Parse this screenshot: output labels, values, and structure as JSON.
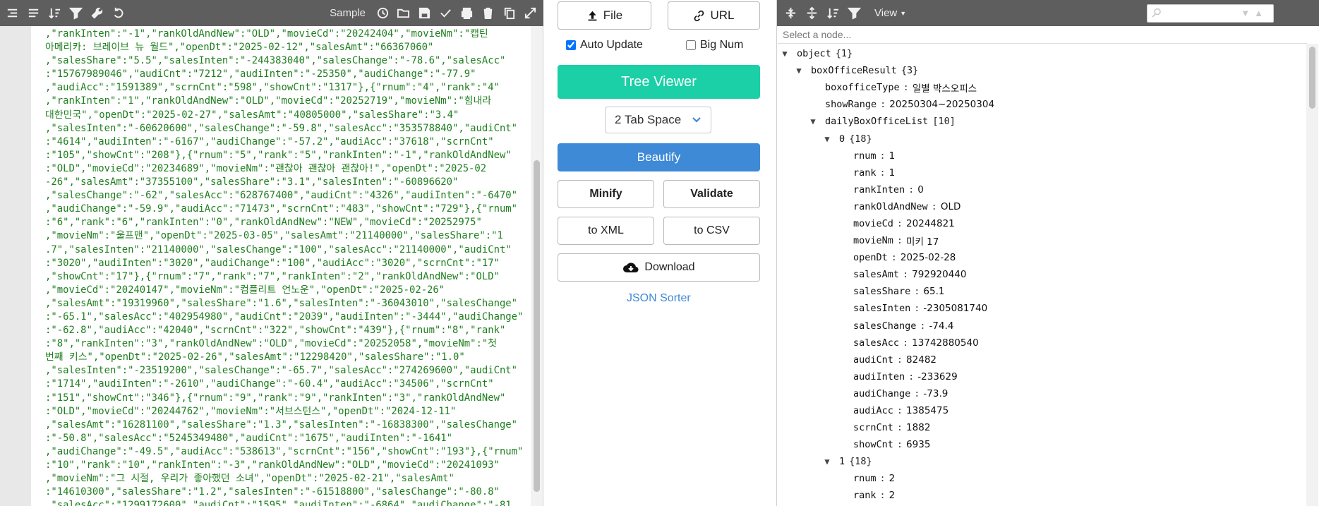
{
  "left": {
    "sample_label": "Sample",
    "code_lines": [
      ",\"rankInten\":\"-1\",\"rankOldAndNew\":\"OLD\",\"movieCd\":\"20242404\",\"movieNm\":\"캡틴",
      "아메리카: 브레이브 뉴 월드\",\"openDt\":\"2025-02-12\",\"salesAmt\":\"66367060\"",
      ",\"salesShare\":\"5.5\",\"salesInten\":\"-244383040\",\"salesChange\":\"-78.6\",\"salesAcc\"",
      ":\"15767989046\",\"audiCnt\":\"7212\",\"audiInten\":\"-25350\",\"audiChange\":\"-77.9\"",
      ",\"audiAcc\":\"1591389\",\"scrnCnt\":\"598\",\"showCnt\":\"1317\"},{\"rnum\":\"4\",\"rank\":\"4\"",
      ",\"rankInten\":\"1\",\"rankOldAndNew\":\"OLD\",\"movieCd\":\"20252719\",\"movieNm\":\"힘내라",
      "대한민국\",\"openDt\":\"2025-02-27\",\"salesAmt\":\"40805000\",\"salesShare\":\"3.4\"",
      ",\"salesInten\":\"-60620600\",\"salesChange\":\"-59.8\",\"salesAcc\":\"353578840\",\"audiCnt\"",
      ":\"4614\",\"audiInten\":\"-6167\",\"audiChange\":\"-57.2\",\"audiAcc\":\"37618\",\"scrnCnt\"",
      ":\"105\",\"showCnt\":\"208\"},{\"rnum\":\"5\",\"rank\":\"5\",\"rankInten\":\"-1\",\"rankOldAndNew\"",
      ":\"OLD\",\"movieCd\":\"20234689\",\"movieNm\":\"괜찮아 괜찮아 괜찮아!\",\"openDt\":\"2025-02",
      "-26\",\"salesAmt\":\"37355100\",\"salesShare\":\"3.1\",\"salesInten\":\"-60896620\"",
      ",\"salesChange\":\"-62\",\"salesAcc\":\"628767400\",\"audiCnt\":\"4326\",\"audiInten\":\"-6470\"",
      ",\"audiChange\":\"-59.9\",\"audiAcc\":\"71473\",\"scrnCnt\":\"483\",\"showCnt\":\"729\"},{\"rnum\"",
      ":\"6\",\"rank\":\"6\",\"rankInten\":\"0\",\"rankOldAndNew\":\"NEW\",\"movieCd\":\"20252975\"",
      ",\"movieNm\":\"울프맨\",\"openDt\":\"2025-03-05\",\"salesAmt\":\"21140000\",\"salesShare\":\"1",
      ".7\",\"salesInten\":\"21140000\",\"salesChange\":\"100\",\"salesAcc\":\"21140000\",\"audiCnt\"",
      ":\"3020\",\"audiInten\":\"3020\",\"audiChange\":\"100\",\"audiAcc\":\"3020\",\"scrnCnt\":\"17\"",
      ",\"showCnt\":\"17\"},{\"rnum\":\"7\",\"rank\":\"7\",\"rankInten\":\"2\",\"rankOldAndNew\":\"OLD\"",
      ",\"movieCd\":\"20240147\",\"movieNm\":\"컴플리트 언노운\",\"openDt\":\"2025-02-26\"",
      ",\"salesAmt\":\"19319960\",\"salesShare\":\"1.6\",\"salesInten\":\"-36043010\",\"salesChange\"",
      ":\"-65.1\",\"salesAcc\":\"402954980\",\"audiCnt\":\"2039\",\"audiInten\":\"-3444\",\"audiChange\"",
      ":\"-62.8\",\"audiAcc\":\"42040\",\"scrnCnt\":\"322\",\"showCnt\":\"439\"},{\"rnum\":\"8\",\"rank\"",
      ":\"8\",\"rankInten\":\"3\",\"rankOldAndNew\":\"OLD\",\"movieCd\":\"20252058\",\"movieNm\":\"첫",
      "번째 키스\",\"openDt\":\"2025-02-26\",\"salesAmt\":\"12298420\",\"salesShare\":\"1.0\"",
      ",\"salesInten\":\"-23519200\",\"salesChange\":\"-65.7\",\"salesAcc\":\"274269600\",\"audiCnt\"",
      ":\"1714\",\"audiInten\":\"-2610\",\"audiChange\":\"-60.4\",\"audiAcc\":\"34506\",\"scrnCnt\"",
      ":\"151\",\"showCnt\":\"346\"},{\"rnum\":\"9\",\"rank\":\"9\",\"rankInten\":\"3\",\"rankOldAndNew\"",
      ":\"OLD\",\"movieCd\":\"20244762\",\"movieNm\":\"서브스턴스\",\"openDt\":\"2024-12-11\"",
      ",\"salesAmt\":\"16281100\",\"salesShare\":\"1.3\",\"salesInten\":\"-16838300\",\"salesChange\"",
      ":\"-50.8\",\"salesAcc\":\"5245349480\",\"audiCnt\":\"1675\",\"audiInten\":\"-1641\"",
      ",\"audiChange\":\"-49.5\",\"audiAcc\":\"538613\",\"scrnCnt\":\"156\",\"showCnt\":\"193\"},{\"rnum\"",
      ":\"10\",\"rank\":\"10\",\"rankInten\":\"-3\",\"rankOldAndNew\":\"OLD\",\"movieCd\":\"20241093\"",
      ",\"movieNm\":\"그 시절, 우리가 좋아했던 소녀\",\"openDt\":\"2025-02-21\",\"salesAmt\"",
      ":\"14610300\",\"salesShare\":\"1.2\",\"salesInten\":\"-61518800\",\"salesChange\":\"-80.8\"",
      ",\"salesAcc\":\"1299172600\",\"audiCnt\":\"1595\",\"audiInten\":\"-6864\",\"audiChange\":\"-81"
    ]
  },
  "mid": {
    "file_label": "File",
    "url_label": "URL",
    "auto_update_label": "Auto Update",
    "auto_update_checked": true,
    "big_num_label": "Big Num",
    "big_num_checked": false,
    "tree_viewer_label": "Tree Viewer",
    "tab_space_value": "2 Tab Space",
    "beautify_label": "Beautify",
    "minify_label": "Minify",
    "validate_label": "Validate",
    "to_xml_label": "to XML",
    "to_csv_label": "to CSV",
    "download_label": "Download",
    "json_sorter_label": "JSON Sorter",
    "colors": {
      "green": "#1bcfa7",
      "blue": "#3f8ad6"
    }
  },
  "right": {
    "view_label": "View",
    "node_placeholder": "Select a node...",
    "tree": [
      {
        "depth": 0,
        "expanded": true,
        "key": "object",
        "count": "{1}"
      },
      {
        "depth": 1,
        "expanded": true,
        "key": "boxOfficeResult",
        "count": "{3}"
      },
      {
        "depth": 2,
        "key": "boxofficeType",
        "value": "일별 박스오피스"
      },
      {
        "depth": 2,
        "key": "showRange",
        "value": "20250304~20250304"
      },
      {
        "depth": 2,
        "expanded": true,
        "key": "dailyBoxOfficeList",
        "count": "[10]"
      },
      {
        "depth": 3,
        "expanded": true,
        "key": "0",
        "count": "{18}"
      },
      {
        "depth": 4,
        "key": "rnum",
        "value": "1"
      },
      {
        "depth": 4,
        "key": "rank",
        "value": "1"
      },
      {
        "depth": 4,
        "key": "rankInten",
        "value": "0"
      },
      {
        "depth": 4,
        "key": "rankOldAndNew",
        "value": "OLD"
      },
      {
        "depth": 4,
        "key": "movieCd",
        "value": "20244821"
      },
      {
        "depth": 4,
        "key": "movieNm",
        "value": "미키 17"
      },
      {
        "depth": 4,
        "key": "openDt",
        "value": "2025-02-28"
      },
      {
        "depth": 4,
        "key": "salesAmt",
        "value": "792920440"
      },
      {
        "depth": 4,
        "key": "salesShare",
        "value": "65.1"
      },
      {
        "depth": 4,
        "key": "salesInten",
        "value": "-2305081740"
      },
      {
        "depth": 4,
        "key": "salesChange",
        "value": "-74.4"
      },
      {
        "depth": 4,
        "key": "salesAcc",
        "value": "13742880540"
      },
      {
        "depth": 4,
        "key": "audiCnt",
        "value": "82482"
      },
      {
        "depth": 4,
        "key": "audiInten",
        "value": "-233629"
      },
      {
        "depth": 4,
        "key": "audiChange",
        "value": "-73.9"
      },
      {
        "depth": 4,
        "key": "audiAcc",
        "value": "1385475"
      },
      {
        "depth": 4,
        "key": "scrnCnt",
        "value": "1882"
      },
      {
        "depth": 4,
        "key": "showCnt",
        "value": "6935"
      },
      {
        "depth": 3,
        "expanded": true,
        "key": "1",
        "count": "{18}"
      },
      {
        "depth": 4,
        "key": "rnum",
        "value": "2"
      },
      {
        "depth": 4,
        "key": "rank",
        "value": "2"
      }
    ]
  }
}
